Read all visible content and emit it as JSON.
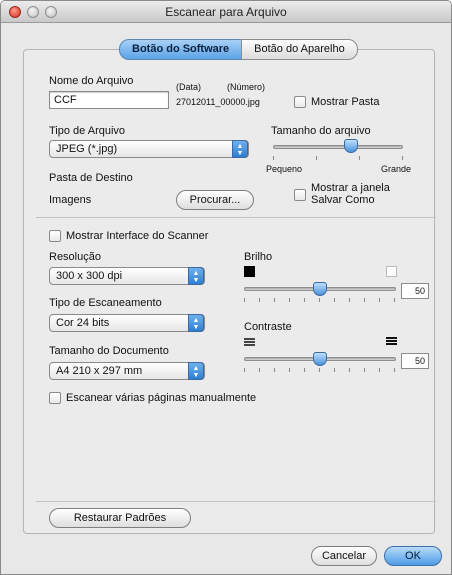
{
  "window": {
    "title": "Escanear para Arquivo"
  },
  "tabs": [
    {
      "label": "Botão do Software",
      "active": true
    },
    {
      "label": "Botão do Aparelho",
      "active": false
    }
  ],
  "file": {
    "name_label": "Nome do Arquivo",
    "date_label": "(Data)",
    "number_label": "(Número)",
    "name_value": "CCF",
    "example_name": "27012011_00000.jpg",
    "show_folder_label": "Mostrar Pasta",
    "type_label": "Tipo de Arquivo",
    "type_value": "JPEG (*.jpg)",
    "size_label": "Tamanho do arquivo",
    "size_small": "Pequeno",
    "size_large": "Grande",
    "size_level": 0.6,
    "dest_label": "Pasta de Destino",
    "dest_value": "Imagens",
    "browse_button": "Procurar...",
    "save_as_line1": "Mostrar a janela",
    "save_as_line2": "Salvar Como"
  },
  "scanner": {
    "show_interface_label": "Mostrar Interface do Scanner",
    "resolution_label": "Resolução",
    "resolution_value": "300 x 300 dpi",
    "scan_type_label": "Tipo de Escaneamento",
    "scan_type_value": "Cor 24 bits",
    "doc_size_label": "Tamanho do Documento",
    "doc_size_value": "A4 210 x 297 mm",
    "brightness_label": "Brilho",
    "brightness_value": "50",
    "contrast_label": "Contraste",
    "contrast_value": "50",
    "manual_pages_label": "Escanear várias páginas manualmente"
  },
  "footer": {
    "restore_button": "Restaurar Padrões",
    "cancel_button": "Cancelar",
    "ok_button": "OK"
  },
  "colors": {
    "accent": "#4d9ae5"
  }
}
